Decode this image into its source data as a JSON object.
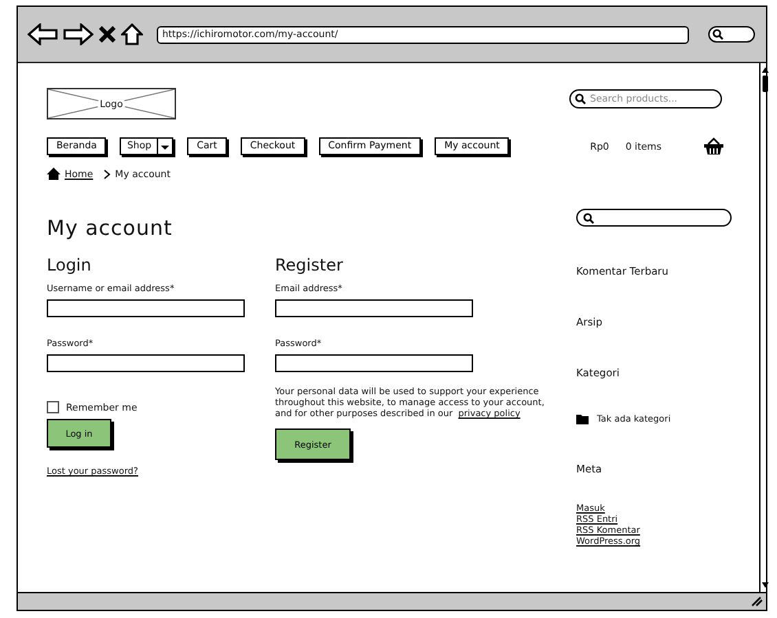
{
  "browser": {
    "url": "https://ichiromotor.com/my-account/"
  },
  "header": {
    "logo": "Logo",
    "search_placeholder": "Search products..."
  },
  "nav": [
    {
      "label": "Beranda",
      "kind": "button"
    },
    {
      "label": "Shop",
      "kind": "dropdown"
    },
    {
      "label": "Cart",
      "kind": "button"
    },
    {
      "label": "Checkout",
      "kind": "button"
    },
    {
      "label": "Confirm Payment",
      "kind": "button"
    },
    {
      "label": "My account",
      "kind": "button"
    }
  ],
  "cart": {
    "total": "Rp0",
    "items": "0 items"
  },
  "breadcrumb": [
    {
      "label": "Home",
      "kind": "home"
    },
    {
      "label": "My account",
      "kind": "current"
    }
  ],
  "page_title": "My account",
  "login": {
    "title": "Login",
    "fields": [
      {
        "label": "Username or email address*"
      },
      {
        "label": "Password*"
      }
    ],
    "remember": {
      "label": "Remember me",
      "checked": false
    },
    "button": "Log in",
    "lost_link": "Lost your password?"
  },
  "register": {
    "title": "Register",
    "fields": [
      {
        "label": "Email address*"
      },
      {
        "label": "Password*"
      }
    ],
    "notice": "Your personal data will be used to support your experience throughout this website, to manage access to your account, and for other purposes described in our",
    "privacy_link": "privacy policy",
    "button": "Register"
  },
  "sidebar": [
    {
      "title": "Komentar Terbaru"
    },
    {
      "title": "Arsip"
    },
    {
      "title": "Kategori",
      "items": [
        {
          "label": "Tak ada kategori",
          "kind": "category"
        }
      ]
    },
    {
      "title": "Meta",
      "items": [
        {
          "label": "Masuk",
          "kind": "link"
        },
        {
          "label": "RSS Entri",
          "kind": "link"
        },
        {
          "label": "RSS Komentar",
          "kind": "link"
        },
        {
          "label": "WordPress.org",
          "kind": "link"
        }
      ]
    }
  ]
}
